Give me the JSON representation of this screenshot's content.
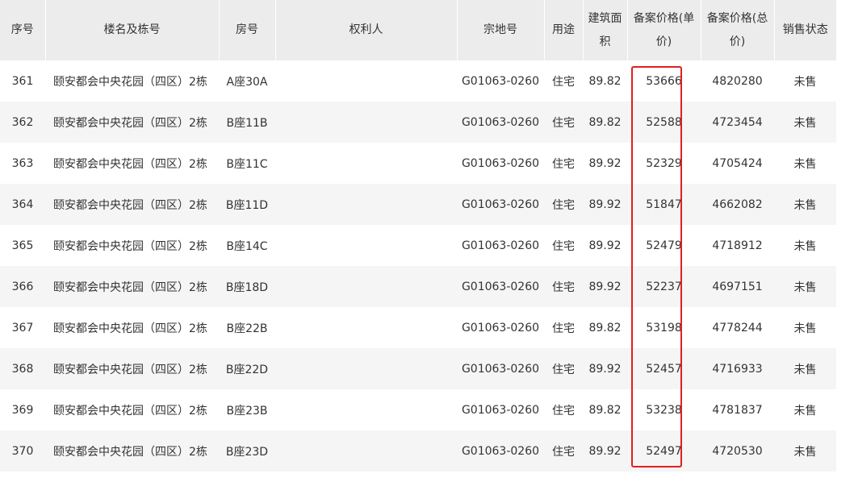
{
  "headers": [
    "序号",
    "楼名及栋号",
    "房号",
    "权利人",
    "宗地号",
    "用途",
    "建筑面积",
    "备案价格(单价)",
    "备案价格(总价)",
    "销售状态"
  ],
  "rows": [
    [
      "361",
      "颐安都会中央花园（四区）2栋",
      "A座30A",
      "",
      "G01063-0260",
      "住宅",
      "89.82",
      "53666",
      "4820280",
      "未售"
    ],
    [
      "362",
      "颐安都会中央花园（四区）2栋",
      "B座11B",
      "",
      "G01063-0260",
      "住宅",
      "89.82",
      "52588",
      "4723454",
      "未售"
    ],
    [
      "363",
      "颐安都会中央花园（四区）2栋",
      "B座11C",
      "",
      "G01063-0260",
      "住宅",
      "89.92",
      "52329",
      "4705424",
      "未售"
    ],
    [
      "364",
      "颐安都会中央花园（四区）2栋",
      "B座11D",
      "",
      "G01063-0260",
      "住宅",
      "89.92",
      "51847",
      "4662082",
      "未售"
    ],
    [
      "365",
      "颐安都会中央花园（四区）2栋",
      "B座14C",
      "",
      "G01063-0260",
      "住宅",
      "89.92",
      "52479",
      "4718912",
      "未售"
    ],
    [
      "366",
      "颐安都会中央花园（四区）2栋",
      "B座18D",
      "",
      "G01063-0260",
      "住宅",
      "89.92",
      "52237",
      "4697151",
      "未售"
    ],
    [
      "367",
      "颐安都会中央花园（四区）2栋",
      "B座22B",
      "",
      "G01063-0260",
      "住宅",
      "89.82",
      "53198",
      "4778244",
      "未售"
    ],
    [
      "368",
      "颐安都会中央花园（四区）2栋",
      "B座22D",
      "",
      "G01063-0260",
      "住宅",
      "89.92",
      "52457",
      "4716933",
      "未售"
    ],
    [
      "369",
      "颐安都会中央花园（四区）2栋",
      "B座23B",
      "",
      "G01063-0260",
      "住宅",
      "89.82",
      "53238",
      "4781837",
      "未售"
    ],
    [
      "370",
      "颐安都会中央花园（四区）2栋",
      "B座23D",
      "",
      "G01063-0260",
      "住宅",
      "89.92",
      "52497",
      "4720530",
      "未售"
    ]
  ],
  "colors": {
    "header_bg": "#ececec",
    "stripe_bg": "#f5f5f5",
    "highlight_border": "#e02020"
  }
}
